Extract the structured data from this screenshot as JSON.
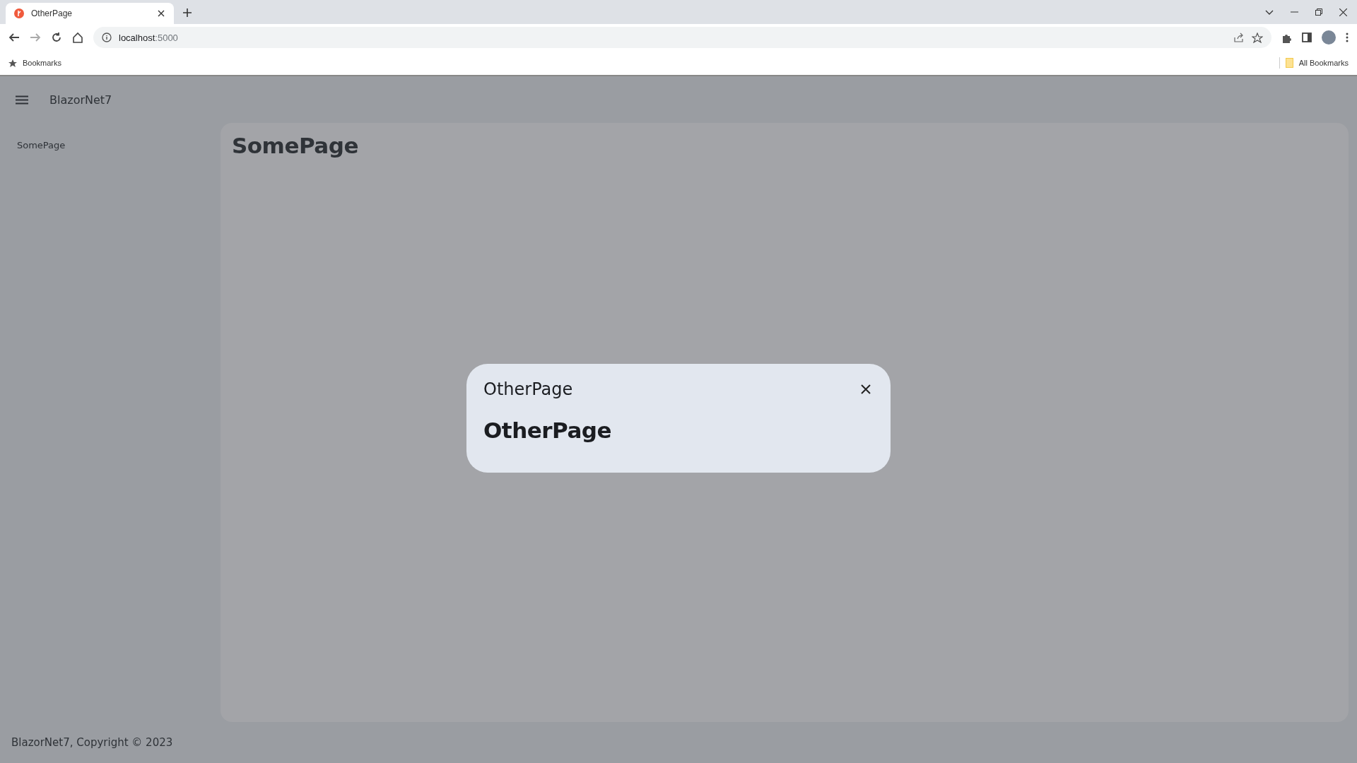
{
  "browser": {
    "tabs": [
      {
        "title": "OtherPage",
        "selected": true
      }
    ],
    "address": {
      "host": "localhost",
      "port": ":5000"
    },
    "bookmarks": [
      {
        "label": "Bookmarks"
      }
    ],
    "all_bookmarks": "All Bookmarks"
  },
  "app": {
    "title": "BlazorNet7",
    "nav": [
      {
        "label": "SomePage",
        "selected": false
      }
    ],
    "page_heading": "SomePage",
    "footer": "BlazorNet7, Copyright © 2023"
  },
  "dialog": {
    "title": "OtherPage",
    "heading": "OtherPage"
  }
}
